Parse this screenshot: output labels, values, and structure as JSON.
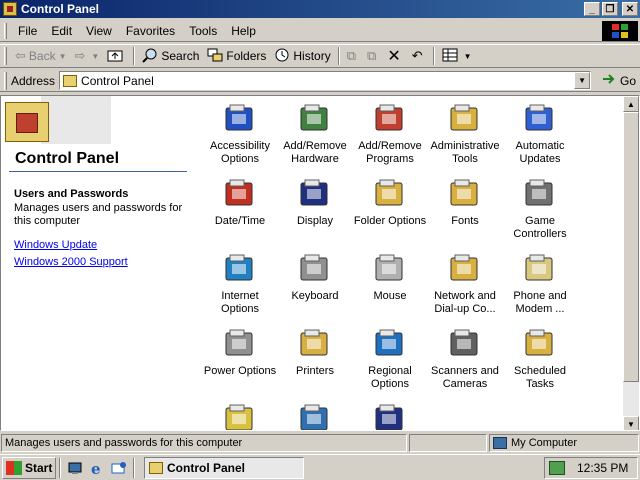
{
  "window": {
    "title": "Control Panel",
    "buttons": {
      "minimize": "_",
      "maximize": "❐",
      "close": "✕"
    }
  },
  "menu": [
    "File",
    "Edit",
    "View",
    "Favorites",
    "Tools",
    "Help"
  ],
  "toolbar": {
    "back": "Back",
    "search": "Search",
    "folders": "Folders",
    "history": "History"
  },
  "address": {
    "label": "Address",
    "value": "Control Panel",
    "go": "Go"
  },
  "left_pane": {
    "title": "Control Panel",
    "selected_title": "Users and Passwords",
    "selected_desc": "Manages users and passwords for this computer",
    "links": [
      "Windows Update",
      "Windows 2000 Support"
    ]
  },
  "items": [
    {
      "label": "Accessibility Options",
      "icon": "accessibility-icon",
      "color": "#2050c0"
    },
    {
      "label": "Add/Remove Hardware",
      "icon": "hardware-icon",
      "color": "#408040"
    },
    {
      "label": "Add/Remove Programs",
      "icon": "programs-icon",
      "color": "#c04030"
    },
    {
      "label": "Administrative Tools",
      "icon": "admin-tools-icon",
      "color": "#d8b040"
    },
    {
      "label": "Automatic Updates",
      "icon": "windows-update-icon",
      "color": "#3060d0"
    },
    {
      "label": "Date/Time",
      "icon": "calendar-clock-icon",
      "color": "#c03020"
    },
    {
      "label": "Display",
      "icon": "display-icon",
      "color": "#203080"
    },
    {
      "label": "Folder Options",
      "icon": "folder-options-icon",
      "color": "#d8b040"
    },
    {
      "label": "Fonts",
      "icon": "fonts-icon",
      "color": "#d8b040"
    },
    {
      "label": "Game Controllers",
      "icon": "joystick-icon",
      "color": "#707070"
    },
    {
      "label": "Internet Options",
      "icon": "globe-icon",
      "color": "#2080c0"
    },
    {
      "label": "Keyboard",
      "icon": "keyboard-icon",
      "color": "#909090"
    },
    {
      "label": "Mouse",
      "icon": "mouse-icon",
      "color": "#b0b0b0"
    },
    {
      "label": "Network and Dial-up Co...",
      "icon": "network-icon",
      "color": "#d8b040"
    },
    {
      "label": "Phone and Modem ...",
      "icon": "phone-icon",
      "color": "#d8c880"
    },
    {
      "label": "Power Options",
      "icon": "power-plug-icon",
      "color": "#909090"
    },
    {
      "label": "Printers",
      "icon": "printers-icon",
      "color": "#d8b040"
    },
    {
      "label": "Regional Options",
      "icon": "globe-icon",
      "color": "#2070c0"
    },
    {
      "label": "Scanners and Cameras",
      "icon": "scanner-icon",
      "color": "#606060"
    },
    {
      "label": "Scheduled Tasks",
      "icon": "scheduled-tasks-icon",
      "color": "#d8b040"
    },
    {
      "label": "",
      "icon": "speaker-icon",
      "color": "#d8c040"
    },
    {
      "label": "",
      "icon": "computer-icon",
      "color": "#3070b0"
    },
    {
      "label": "",
      "icon": "users-icon",
      "color": "#203080"
    }
  ],
  "status": {
    "text": "Manages users and passwords for this computer",
    "zone": "My Computer"
  },
  "taskbar": {
    "start": "Start",
    "task": "Control Panel",
    "clock": "12:35 PM"
  }
}
